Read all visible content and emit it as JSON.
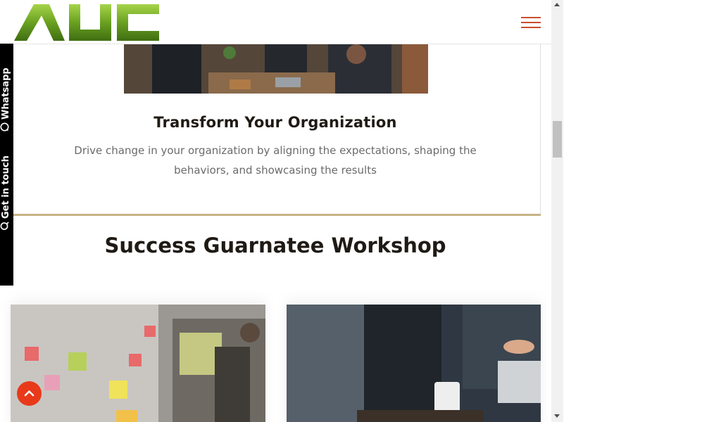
{
  "header": {
    "logo_text": "AUC",
    "menu_icon": "hamburger-menu-icon"
  },
  "feature_card": {
    "title": "Transform Your Organization",
    "description": "Drive change in your organization by aligning the expectations, shaping the behaviors, and showcasing the results"
  },
  "section": {
    "title": "Success Guarnatee Workshop"
  },
  "side_tab": {
    "whatsapp_label": "Whatsapp",
    "whatsapp_icon": "whatsapp-icon",
    "contact_label": "Get in touch",
    "contact_icon": "chat-icon"
  },
  "back_to_top": {
    "icon": "chevron-up-icon"
  },
  "colors": {
    "brand_green": "#6aa121",
    "accent_orange": "#c8502a",
    "back_to_top_red": "#e8391b",
    "gold_rule": "#c6b285",
    "heading": "#1f1a14",
    "body_text": "#6b6b6b"
  }
}
